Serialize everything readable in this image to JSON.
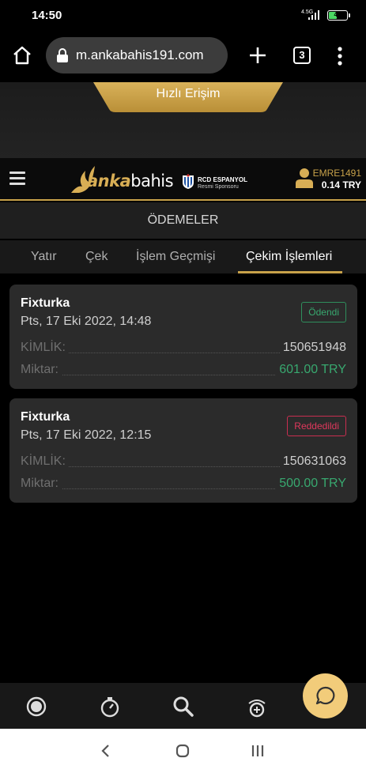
{
  "status_bar": {
    "time": "14:50",
    "network": "4.5G",
    "battery": "43",
    "battery_color": "#4cd964"
  },
  "browser": {
    "url": "m.ankabahis191.com",
    "tab_count": "3",
    "icons": [
      "home-icon",
      "lock-icon",
      "plus-icon",
      "tabs-icon",
      "menu-kebab-icon"
    ]
  },
  "quick_access": {
    "label": "Hızlı Erişim"
  },
  "header": {
    "logo_text_accent": "anka",
    "logo_text_rest": "bahis",
    "sponsor_line1": "RCD ESPANYOL",
    "sponsor_line2": "Resmi Sponsoru",
    "username": "EMRE1491",
    "balance": "0.14 TRY",
    "brand_color": "#c8a24a"
  },
  "page": {
    "title": "ÖDEMELER",
    "tabs": [
      {
        "label": "Yatır",
        "active": false
      },
      {
        "label": "Çek",
        "active": false
      },
      {
        "label": "İşlem Geçmişi",
        "active": false
      },
      {
        "label": "Çekim İşlemleri",
        "active": true
      }
    ]
  },
  "transactions": [
    {
      "method": "Fixturka",
      "date": "Pts, 17 Eki 2022, 14:48",
      "status": "Ödendi",
      "status_color": "#38a86f",
      "id_label": "KİMLİK:",
      "id": "150651948",
      "amount_label": "Miktar:",
      "amount": "601.00 TRY"
    },
    {
      "method": "Fixturka",
      "date": "Pts, 17 Eki 2022, 12:15",
      "status": "Reddedildi",
      "status_color": "#e0385c",
      "id_label": "KİMLİK:",
      "id": "150631063",
      "amount_label": "Miktar:",
      "amount": "500.00 TRY"
    }
  ],
  "bottom_nav": {
    "icons": [
      "live-icon",
      "stopwatch-icon",
      "search-icon",
      "casino-wheel-icon",
      "chat-icon"
    ],
    "chat_color": "#f2cc7a"
  },
  "system_nav": {
    "icons": [
      "back-icon",
      "home-circle-icon",
      "recents-icon"
    ]
  }
}
